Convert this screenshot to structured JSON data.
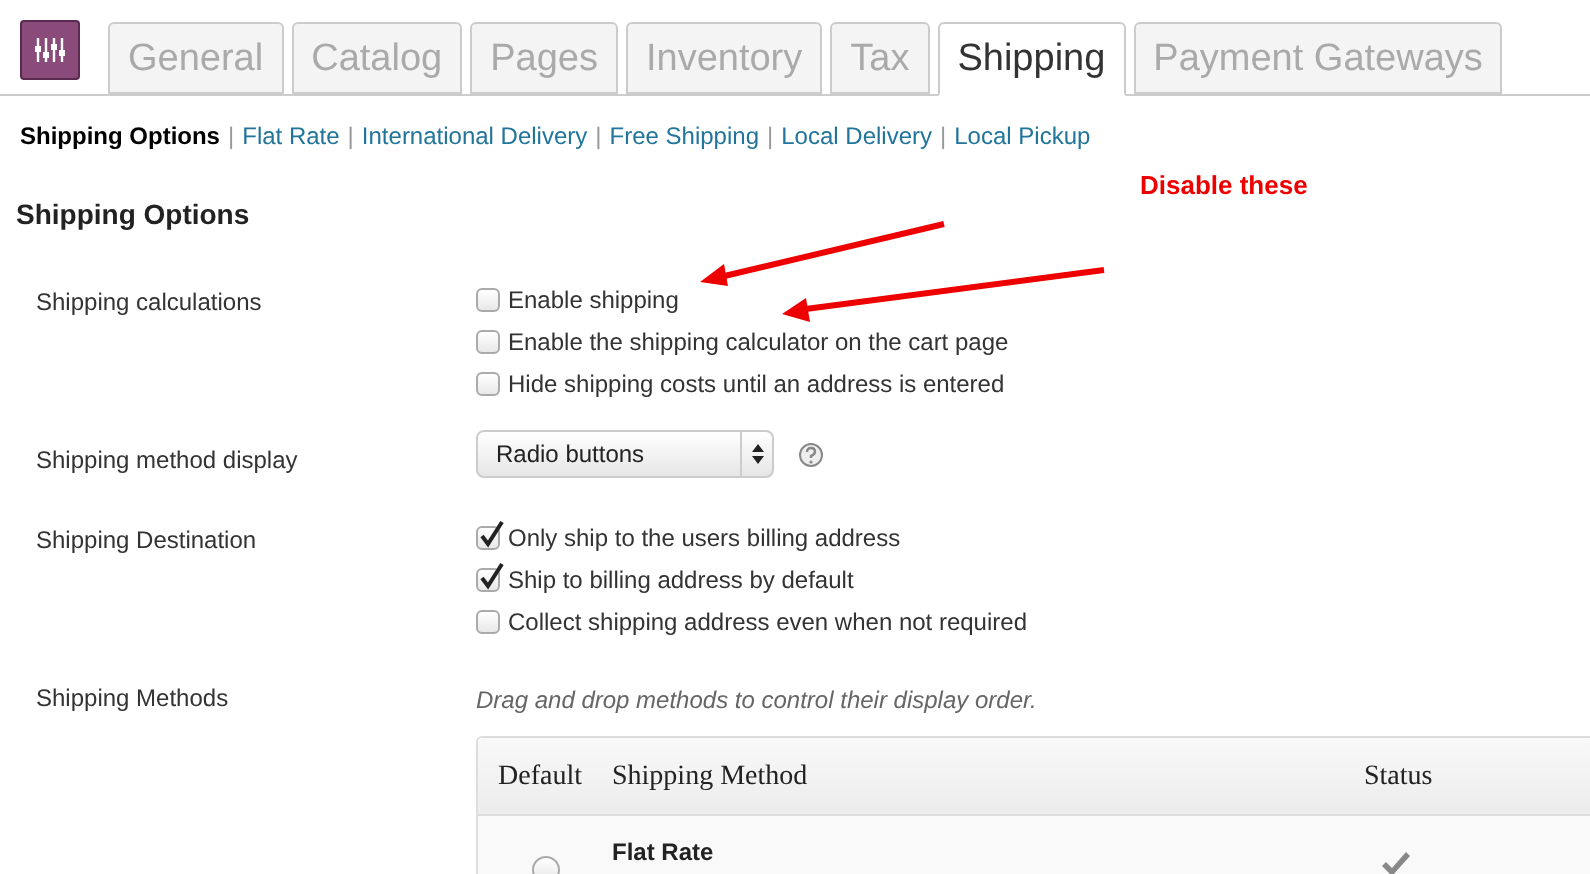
{
  "tabs": [
    {
      "label": "General",
      "selected": false
    },
    {
      "label": "Catalog",
      "selected": false
    },
    {
      "label": "Pages",
      "selected": false
    },
    {
      "label": "Inventory",
      "selected": false
    },
    {
      "label": "Tax",
      "selected": false
    },
    {
      "label": "Shipping",
      "selected": true
    },
    {
      "label": "Payment Gateways",
      "selected": false
    }
  ],
  "subnav": [
    {
      "label": "Shipping Options",
      "selected": true
    },
    {
      "label": "Flat Rate",
      "selected": false
    },
    {
      "label": "International Delivery",
      "selected": false
    },
    {
      "label": "Free Shipping",
      "selected": false
    },
    {
      "label": "Local Delivery",
      "selected": false
    },
    {
      "label": "Local Pickup",
      "selected": false
    }
  ],
  "subnav_separator": "|",
  "heading": "Shipping Options",
  "annotation": "Disable these",
  "settings": [
    {
      "kind": "checkboxes",
      "label": "Shipping calculations",
      "options": [
        {
          "label": "Enable shipping",
          "checked": false
        },
        {
          "label": "Enable the shipping calculator on the cart page",
          "checked": false
        },
        {
          "label": "Hide shipping costs until an address is entered",
          "checked": false
        }
      ]
    },
    {
      "kind": "select",
      "label": "Shipping method display",
      "value": "Radio buttons"
    },
    {
      "kind": "checkboxes",
      "label": "Shipping Destination",
      "options": [
        {
          "label": "Only ship to the users billing address",
          "checked": true
        },
        {
          "label": "Ship to billing address by default",
          "checked": true
        },
        {
          "label": "Collect shipping address even when not required",
          "checked": false
        }
      ]
    },
    {
      "kind": "table",
      "label": "Shipping Methods",
      "hint": "Drag and drop methods to control their display order.",
      "columns": [
        "Default",
        "Shipping Method",
        "Status"
      ],
      "rows": [
        {
          "name": "Flat Rate",
          "default": false,
          "enabled": true
        }
      ]
    }
  ]
}
